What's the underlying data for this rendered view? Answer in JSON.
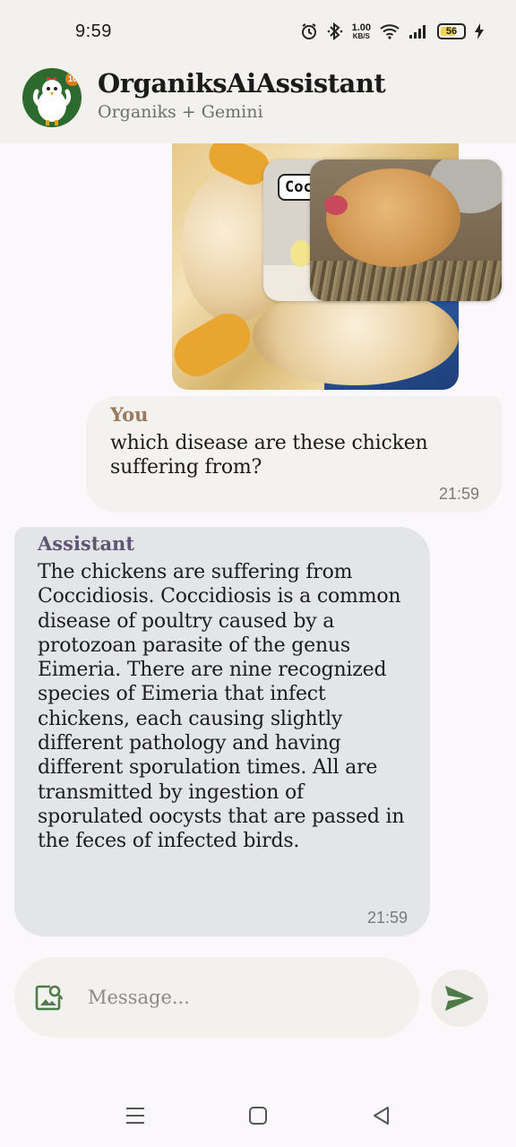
{
  "status_bar": {
    "time": "9:59",
    "net_speed_value": "1.00",
    "net_speed_unit": "KB/S",
    "battery_level": "56"
  },
  "header": {
    "title": "OrganiksAiAssistant",
    "subtitle": "Organiks + Gemini",
    "avatar_badge": "10",
    "avatar_icon": "chicken-mascot-avatar"
  },
  "attachment": {
    "overlay_label": "Coc"
  },
  "messages": [
    {
      "sender": "You",
      "text": "which disease are these chicken suffering from?",
      "time": "21:59"
    },
    {
      "sender": "Assistant",
      "text": "The chickens are suffering from Coccidiosis. Coccidiosis is a common disease of poultry caused by a protozoan parasite of the genus Eimeria. There are nine recognized species of Eimeria that infect chickens, each causing slightly different pathology and having different sporulation times. All are transmitted by ingestion of sporulated oocysts that are passed in the feces of infected birds.",
      "time": "21:59"
    }
  ],
  "composer": {
    "placeholder": "Message...",
    "image_icon": "image-search-icon",
    "send_icon": "send-icon"
  },
  "colors": {
    "accent_green": "#4f7a4a",
    "user_bubble": "#f3f2f0",
    "assistant_bubble": "#e4e5e9",
    "header_bg": "#f3f1ee"
  }
}
